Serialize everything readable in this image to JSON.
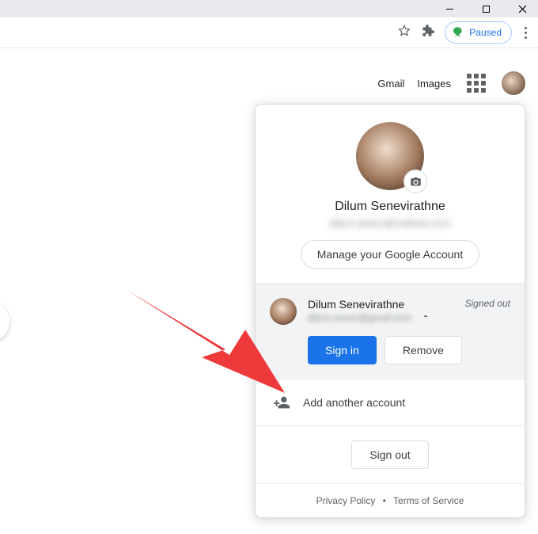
{
  "window": {
    "minimize": "–",
    "maximize": "❐",
    "close": "✕"
  },
  "toolbar": {
    "paused_label": "Paused"
  },
  "nav": {
    "gmail": "Gmail",
    "images": "Images"
  },
  "account": {
    "name": "Dilum Senevirathne",
    "email_masked": "dilum.senev@outlook.com",
    "manage_label": "Manage your Google Account",
    "secondary": {
      "name": "Dilum Senevirathne",
      "email_masked": "dilum.senev@gmail.com",
      "status": "Signed out",
      "signin_label": "Sign in",
      "remove_label": "Remove"
    },
    "add_label": "Add another account",
    "signout_label": "Sign out",
    "privacy_label": "Privacy Policy",
    "terms_label": "Terms of Service"
  }
}
